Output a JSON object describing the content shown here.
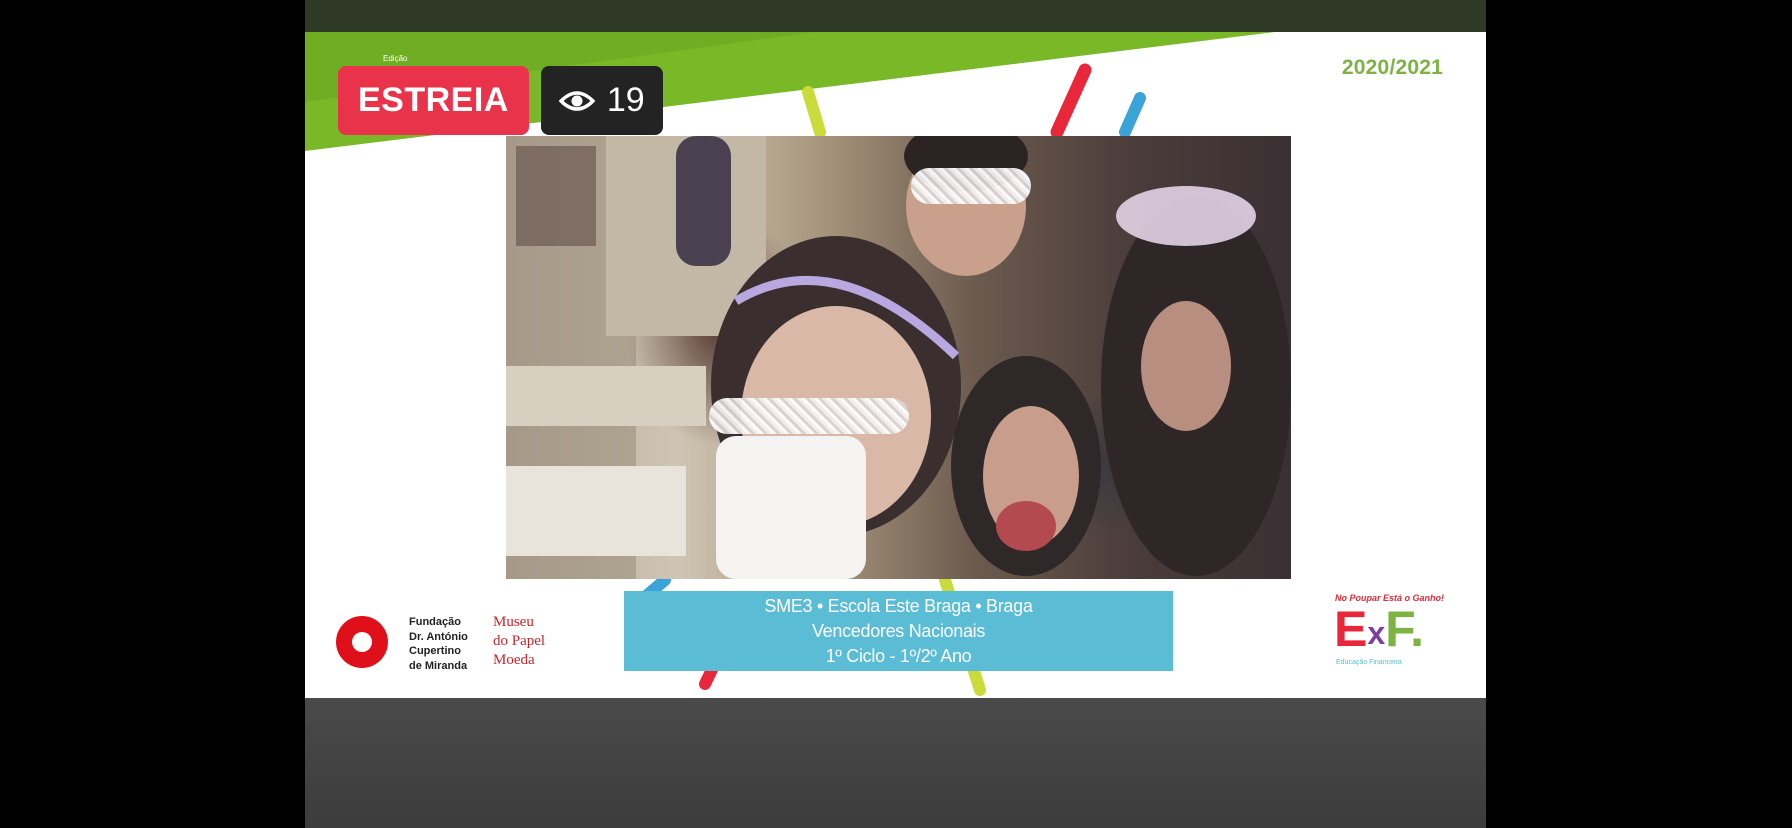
{
  "status_badge": {
    "label": "ESTREIA"
  },
  "viewers": {
    "count": "19",
    "icon": "eye-icon"
  },
  "slide": {
    "edition_small": "Edição",
    "year": "2020/2021",
    "caption": {
      "line1": "SME3 • Escola Este Braga • Braga",
      "line2": "Vencedores Nacionais",
      "line3": "1º Ciclo - 1º/2º Ano"
    },
    "foundation": {
      "line1": "Fundação",
      "line2": "Dr. António",
      "line3": "Cupertino",
      "line4": "de Miranda"
    },
    "museum": {
      "line1": "Museu",
      "line2": "do Papel",
      "line3": "Moeda"
    },
    "exf": {
      "tagline": "No Poupar Está o Ganho!",
      "letter_e": "E",
      "letter_x": "x",
      "letter_f": "F.",
      "subtitle": "Educação Financeira"
    }
  },
  "colors": {
    "live_badge": "#e8334a",
    "viewers_badge": "#232323",
    "slide_green": "#7cb342",
    "caption_blue": "#5bbcd6",
    "brand_red": "#e0101a"
  }
}
